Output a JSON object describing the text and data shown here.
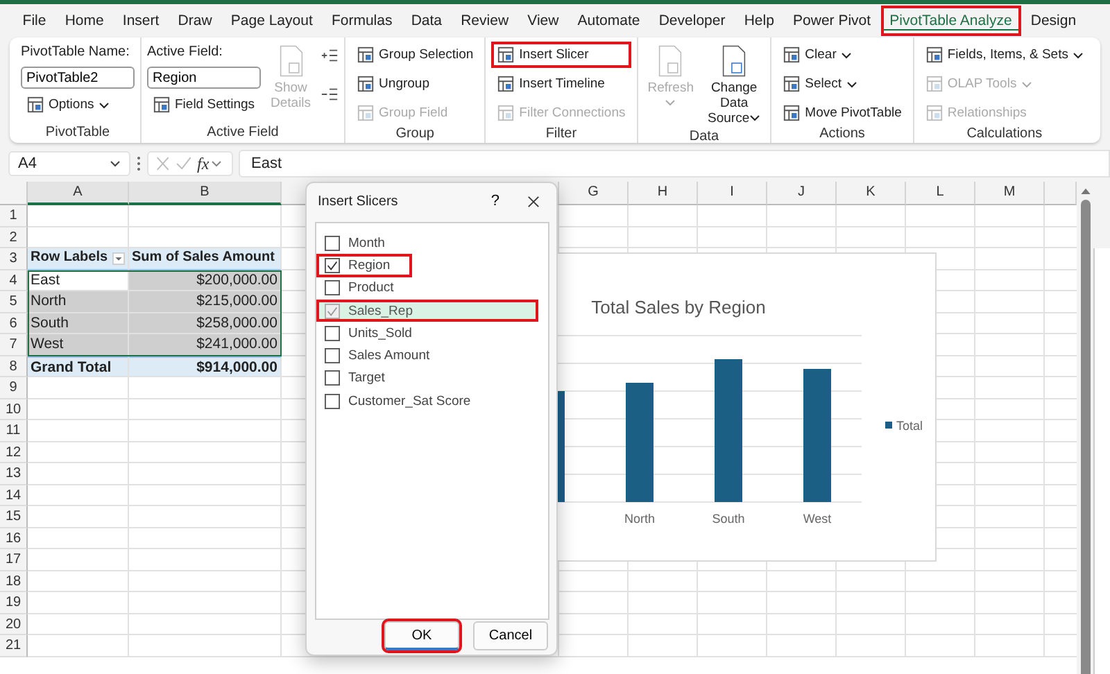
{
  "menu": {
    "tabs": [
      {
        "label": "File",
        "selected": false,
        "highlighted": false
      },
      {
        "label": "Home",
        "selected": false,
        "highlighted": false
      },
      {
        "label": "Insert",
        "selected": false,
        "highlighted": false
      },
      {
        "label": "Draw",
        "selected": false,
        "highlighted": false
      },
      {
        "label": "Page Layout",
        "selected": false,
        "highlighted": false
      },
      {
        "label": "Formulas",
        "selected": false,
        "highlighted": false
      },
      {
        "label": "Data",
        "selected": false,
        "highlighted": false
      },
      {
        "label": "Review",
        "selected": false,
        "highlighted": false
      },
      {
        "label": "View",
        "selected": false,
        "highlighted": false
      },
      {
        "label": "Automate",
        "selected": false,
        "highlighted": false
      },
      {
        "label": "Developer",
        "selected": false,
        "highlighted": false
      },
      {
        "label": "Help",
        "selected": false,
        "highlighted": false
      },
      {
        "label": "Power Pivot",
        "selected": false,
        "highlighted": false
      },
      {
        "label": "PivotTable Analyze",
        "selected": true,
        "highlighted": true
      },
      {
        "label": "Design",
        "selected": false,
        "highlighted": false
      }
    ]
  },
  "ribbon": {
    "groups": [
      {
        "label": "PivotTable",
        "columns": [
          [
            {
              "kind": "label",
              "text": "PivotTable Name:"
            },
            {
              "kind": "input",
              "value": "PivotTable2"
            },
            {
              "kind": "small",
              "text": "Options",
              "dropdown": true,
              "disabled": false,
              "highlighted": false
            }
          ]
        ]
      },
      {
        "label": "Active Field",
        "columns": [
          [
            {
              "kind": "label",
              "text": "Active Field:"
            },
            {
              "kind": "input",
              "value": "Region"
            },
            {
              "kind": "small",
              "text": "Field Settings",
              "dropdown": false,
              "disabled": false,
              "highlighted": false
            }
          ],
          [
            {
              "kind": "large",
              "text": "Show Details",
              "dropdown": false,
              "disabled": true,
              "highlighted": false
            }
          ],
          [
            {
              "kind": "expand"
            },
            {
              "kind": "collapse"
            }
          ]
        ]
      },
      {
        "label": "Group",
        "columns": [
          [
            {
              "kind": "small",
              "text": "Group Selection",
              "dropdown": false,
              "disabled": false,
              "highlighted": false
            },
            {
              "kind": "small",
              "text": "Ungroup",
              "dropdown": false,
              "disabled": false,
              "highlighted": false
            },
            {
              "kind": "small",
              "text": "Group Field",
              "dropdown": false,
              "disabled": true,
              "highlighted": false
            }
          ]
        ]
      },
      {
        "label": "Filter",
        "columns": [
          [
            {
              "kind": "small",
              "text": "Insert Slicer",
              "dropdown": false,
              "disabled": false,
              "highlighted": true
            },
            {
              "kind": "small",
              "text": "Insert Timeline",
              "dropdown": false,
              "disabled": false,
              "highlighted": false
            },
            {
              "kind": "small",
              "text": "Filter Connections",
              "dropdown": false,
              "disabled": true,
              "highlighted": false
            }
          ]
        ]
      },
      {
        "label": "Data",
        "columns": [
          [
            {
              "kind": "large",
              "text": "Refresh",
              "dropdown": true,
              "disabled": true,
              "highlighted": false
            }
          ],
          [
            {
              "kind": "large",
              "text": "Change Data Source",
              "dropdown": true,
              "disabled": false,
              "highlighted": false
            }
          ]
        ]
      },
      {
        "label": "Actions",
        "columns": [
          [
            {
              "kind": "small",
              "text": "Clear",
              "dropdown": true,
              "disabled": false,
              "highlighted": false
            },
            {
              "kind": "small",
              "text": "Select",
              "dropdown": true,
              "disabled": false,
              "highlighted": false
            },
            {
              "kind": "small",
              "text": "Move PivotTable",
              "dropdown": false,
              "disabled": false,
              "highlighted": false
            }
          ]
        ]
      },
      {
        "label": "Calculations",
        "columns": [
          [
            {
              "kind": "small",
              "text": "Fields, Items, & Sets",
              "dropdown": true,
              "disabled": false,
              "highlighted": false
            },
            {
              "kind": "small",
              "text": "OLAP Tools",
              "dropdown": true,
              "disabled": true,
              "highlighted": false
            },
            {
              "kind": "small",
              "text": "Relationships",
              "dropdown": false,
              "disabled": true,
              "highlighted": false
            }
          ]
        ]
      }
    ]
  },
  "formula_bar": {
    "name_box": "A4",
    "function_label": "fx",
    "formula": "East"
  },
  "sheet": {
    "columns": [
      "A",
      "B",
      "G",
      "H",
      "I",
      "J",
      "K",
      "L",
      "M"
    ],
    "rows": [
      {
        "number": "1",
        "kind": "empty"
      },
      {
        "number": "2",
        "kind": "empty"
      },
      {
        "number": "3",
        "kind": "header",
        "cells": [
          "Row Labels",
          "Sum of Sales Amount"
        ]
      },
      {
        "number": "4",
        "kind": "data",
        "active": true,
        "cells": [
          "East",
          "$200,000.00"
        ]
      },
      {
        "number": "5",
        "kind": "data",
        "active": false,
        "cells": [
          "North",
          "$215,000.00"
        ]
      },
      {
        "number": "6",
        "kind": "data",
        "active": false,
        "cells": [
          "South",
          "$258,000.00"
        ]
      },
      {
        "number": "7",
        "kind": "data",
        "active": false,
        "cells": [
          "West",
          "$241,000.00"
        ]
      },
      {
        "number": "8",
        "kind": "total",
        "cells": [
          "Grand Total",
          "$914,000.00"
        ]
      },
      {
        "number": "9",
        "kind": "empty"
      },
      {
        "number": "10",
        "kind": "empty"
      },
      {
        "number": "11",
        "kind": "empty"
      },
      {
        "number": "12",
        "kind": "empty"
      },
      {
        "number": "13",
        "kind": "empty"
      },
      {
        "number": "14",
        "kind": "empty"
      },
      {
        "number": "15",
        "kind": "empty"
      },
      {
        "number": "16",
        "kind": "empty"
      },
      {
        "number": "17",
        "kind": "empty"
      },
      {
        "number": "18",
        "kind": "empty"
      },
      {
        "number": "19",
        "kind": "empty"
      },
      {
        "number": "20",
        "kind": "empty"
      },
      {
        "number": "21",
        "kind": "empty"
      }
    ]
  },
  "chart": {
    "title": "Total Sales by Region",
    "categories": [
      "North",
      "South",
      "West"
    ],
    "legend": "Total"
  },
  "dialog": {
    "title": "Insert Slicers",
    "help": "?",
    "fields": [
      {
        "label": "Month",
        "checked": false,
        "disabled": false,
        "selected": false,
        "highlighted": false
      },
      {
        "label": "Region",
        "checked": true,
        "disabled": false,
        "selected": false,
        "highlighted": true
      },
      {
        "label": "Product",
        "checked": false,
        "disabled": false,
        "selected": false,
        "highlighted": false
      },
      {
        "label": "Sales_Rep",
        "checked": true,
        "disabled": true,
        "selected": true,
        "highlighted": true
      },
      {
        "label": "Units_Sold",
        "checked": false,
        "disabled": false,
        "selected": false,
        "highlighted": false
      },
      {
        "label": "Sales Amount",
        "checked": false,
        "disabled": false,
        "selected": false,
        "highlighted": false
      },
      {
        "label": "Target",
        "checked": false,
        "disabled": false,
        "selected": false,
        "highlighted": false
      },
      {
        "label": "Customer_Sat Score",
        "checked": false,
        "disabled": false,
        "selected": false,
        "highlighted": false
      }
    ],
    "buttons": [
      {
        "label": "OK",
        "highlighted": true
      },
      {
        "label": "Cancel",
        "highlighted": false
      }
    ]
  }
}
